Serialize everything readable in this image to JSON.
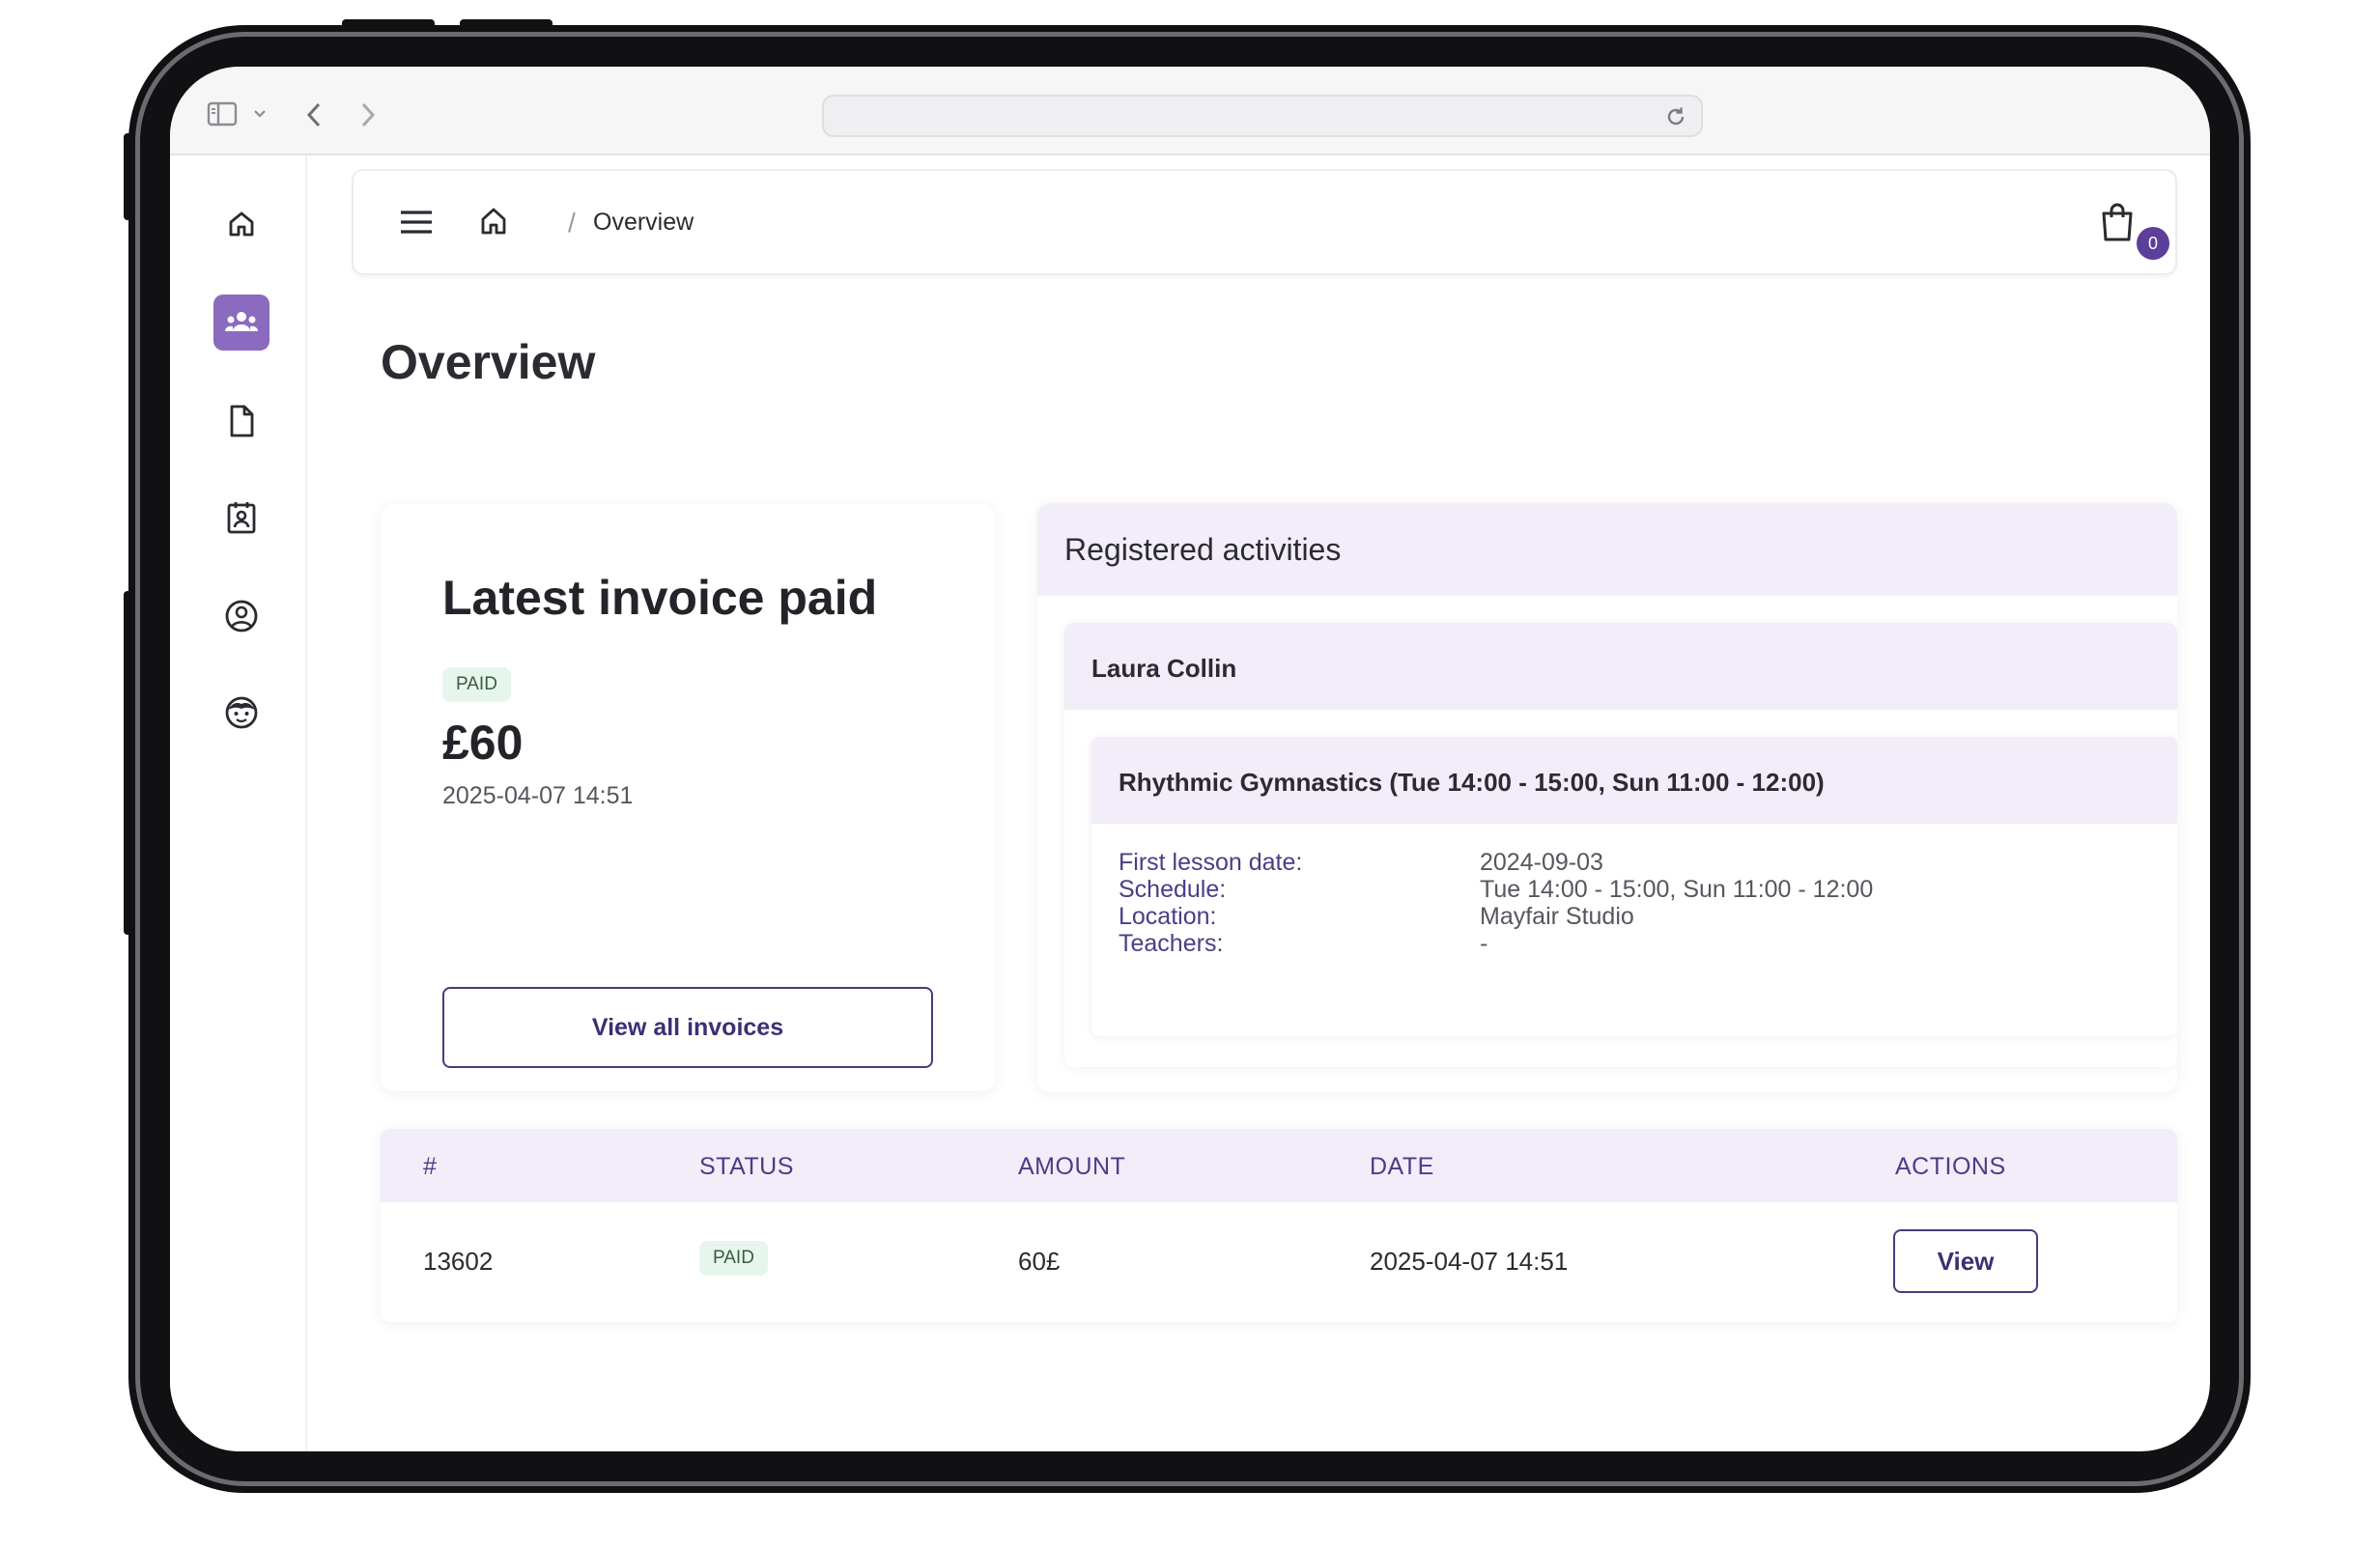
{
  "breadcrumb": {
    "current": "Overview"
  },
  "cart": {
    "count": "0"
  },
  "page": {
    "title": "Overview"
  },
  "invoice_card": {
    "title": "Latest invoice paid",
    "status": "PAID",
    "amount": "£60",
    "date": "2025-04-07 14:51",
    "button_label": "View all invoices"
  },
  "activities": {
    "title": "Registered activities",
    "person": "Laura Collin",
    "activity_title": "Rhythmic Gymnastics (Tue 14:00 - 15:00, Sun 11:00 - 12:00)",
    "details": [
      {
        "label": "First lesson date:",
        "value": "2024-09-03"
      },
      {
        "label": "Schedule:",
        "value": "Tue 14:00 - 15:00, Sun 11:00 - 12:00"
      },
      {
        "label": "Location:",
        "value": "Mayfair Studio"
      },
      {
        "label": "Teachers:",
        "value": "-"
      }
    ]
  },
  "invoices_table": {
    "columns": [
      "#",
      "STATUS",
      "AMOUNT",
      "DATE",
      "ACTIONS"
    ],
    "rows": [
      {
        "id": "13602",
        "status": "PAID",
        "amount": "60£",
        "date": "2025-04-07 14:51",
        "action": "View"
      }
    ]
  },
  "sidebar": {
    "items": [
      {
        "icon": "home-icon"
      },
      {
        "icon": "users-group-icon",
        "active": true
      },
      {
        "icon": "document-icon"
      },
      {
        "icon": "contact-card-icon"
      },
      {
        "icon": "user-circle-icon"
      },
      {
        "icon": "child-face-icon"
      }
    ]
  },
  "colors": {
    "accent": "#8a6bbf",
    "accent_dark": "#4b3d87",
    "header_tint": "#f2edf9",
    "paid_badge_bg": "#e7f6ec"
  }
}
